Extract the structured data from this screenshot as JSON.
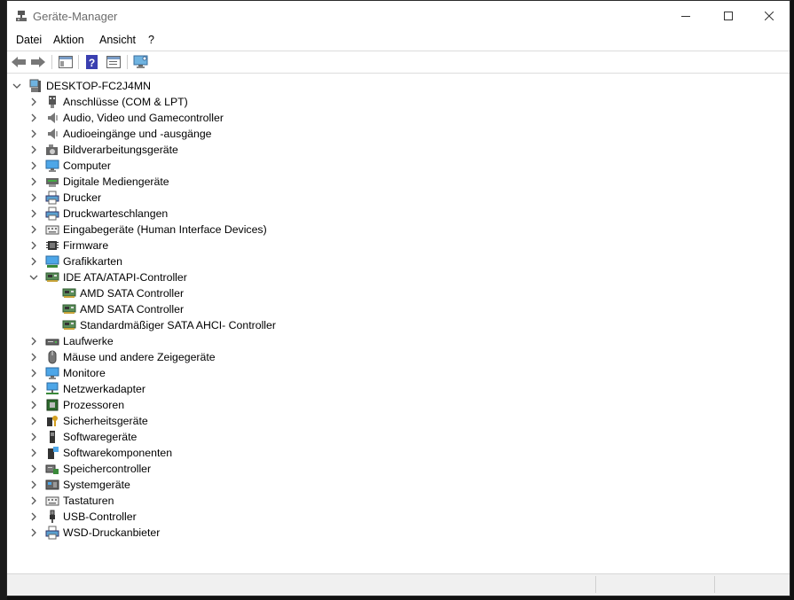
{
  "window": {
    "title": "Geräte-Manager"
  },
  "menu": [
    "Datei",
    "Aktion",
    "Ansicht",
    "?"
  ],
  "toolbar": [
    {
      "name": "back-button",
      "icon": "back-arrow-icon"
    },
    {
      "name": "forward-button",
      "icon": "forward-arrow-icon"
    },
    {
      "name": "show-hide-console-tree-button",
      "icon": "console-tree-icon"
    },
    {
      "name": "help-button",
      "icon": "help-icon"
    },
    {
      "name": "properties-button",
      "icon": "properties-icon"
    },
    {
      "name": "scan-hardware-button",
      "icon": "monitor-scan-icon"
    }
  ],
  "tree": {
    "root": {
      "label": "DESKTOP-FC2J4MN",
      "icon": "computer-icon",
      "expanded": true
    },
    "categories": [
      {
        "label": "Anschlüsse (COM & LPT)",
        "icon": "port-icon"
      },
      {
        "label": "Audio, Video und Gamecontroller",
        "icon": "speaker-icon"
      },
      {
        "label": "Audioeingänge und -ausgänge",
        "icon": "speaker-icon"
      },
      {
        "label": "Bildverarbeitungsgeräte",
        "icon": "camera-icon"
      },
      {
        "label": "Computer",
        "icon": "monitor-icon"
      },
      {
        "label": "Digitale Mediengeräte",
        "icon": "media-device-icon"
      },
      {
        "label": "Drucker",
        "icon": "printer-icon"
      },
      {
        "label": "Druckwarteschlangen",
        "icon": "printer-icon"
      },
      {
        "label": "Eingabegeräte (Human Interface Devices)",
        "icon": "keyboard-icon"
      },
      {
        "label": "Firmware",
        "icon": "chip-icon"
      },
      {
        "label": "Grafikkarten",
        "icon": "display-adapter-icon"
      },
      {
        "label": "IDE ATA/ATAPI-Controller",
        "icon": "controller-card-icon",
        "expanded": true,
        "children": [
          {
            "label": "AMD SATA Controller",
            "icon": "controller-card-icon"
          },
          {
            "label": "AMD SATA Controller",
            "icon": "controller-card-icon"
          },
          {
            "label": "Standardmäßiger SATA AHCI- Controller",
            "icon": "controller-card-icon"
          }
        ]
      },
      {
        "label": "Laufwerke",
        "icon": "disk-drive-icon"
      },
      {
        "label": "Mäuse und andere Zeigegeräte",
        "icon": "mouse-icon"
      },
      {
        "label": "Monitore",
        "icon": "monitor-icon"
      },
      {
        "label": "Netzwerkadapter",
        "icon": "network-icon"
      },
      {
        "label": "Prozessoren",
        "icon": "processor-icon"
      },
      {
        "label": "Sicherheitsgeräte",
        "icon": "security-key-icon"
      },
      {
        "label": "Softwaregeräte",
        "icon": "software-device-icon"
      },
      {
        "label": "Softwarekomponenten",
        "icon": "software-component-icon"
      },
      {
        "label": "Speichercontroller",
        "icon": "storage-controller-icon"
      },
      {
        "label": "Systemgeräte",
        "icon": "system-device-icon"
      },
      {
        "label": "Tastaturen",
        "icon": "keyboard-icon"
      },
      {
        "label": "USB-Controller",
        "icon": "usb-icon"
      },
      {
        "label": "WSD-Druckanbieter",
        "icon": "printer-icon"
      }
    ]
  }
}
